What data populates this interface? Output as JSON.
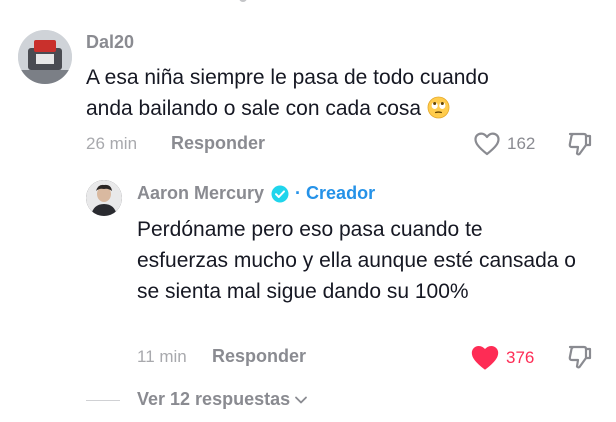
{
  "comments": [
    {
      "username": "Dal20",
      "text": "A esa niña siempre le pasa de todo cuando anda bailando o sale con cada cosa",
      "emoji": "face-with-rolling-eyes-icon",
      "time": "26 min",
      "reply_label": "Responder",
      "likes": "162",
      "liked": false
    },
    {
      "username": "Aaron Mercury",
      "verified": true,
      "badge": "Creador",
      "text": "Perdóname pero eso pasa cuando te esfuerzas mucho y ella aunque esté cansada o se sienta mal sigue dando su 100%",
      "time": "11 min",
      "reply_label": "Responder",
      "likes": "376",
      "liked": true
    }
  ],
  "view_replies": "Ver 12 respuestas",
  "colors": {
    "username": "#8a8b91",
    "text": "#161823",
    "meta": "#a8a9ad",
    "creator": "#2592e8",
    "like_active": "#fe2c55"
  }
}
